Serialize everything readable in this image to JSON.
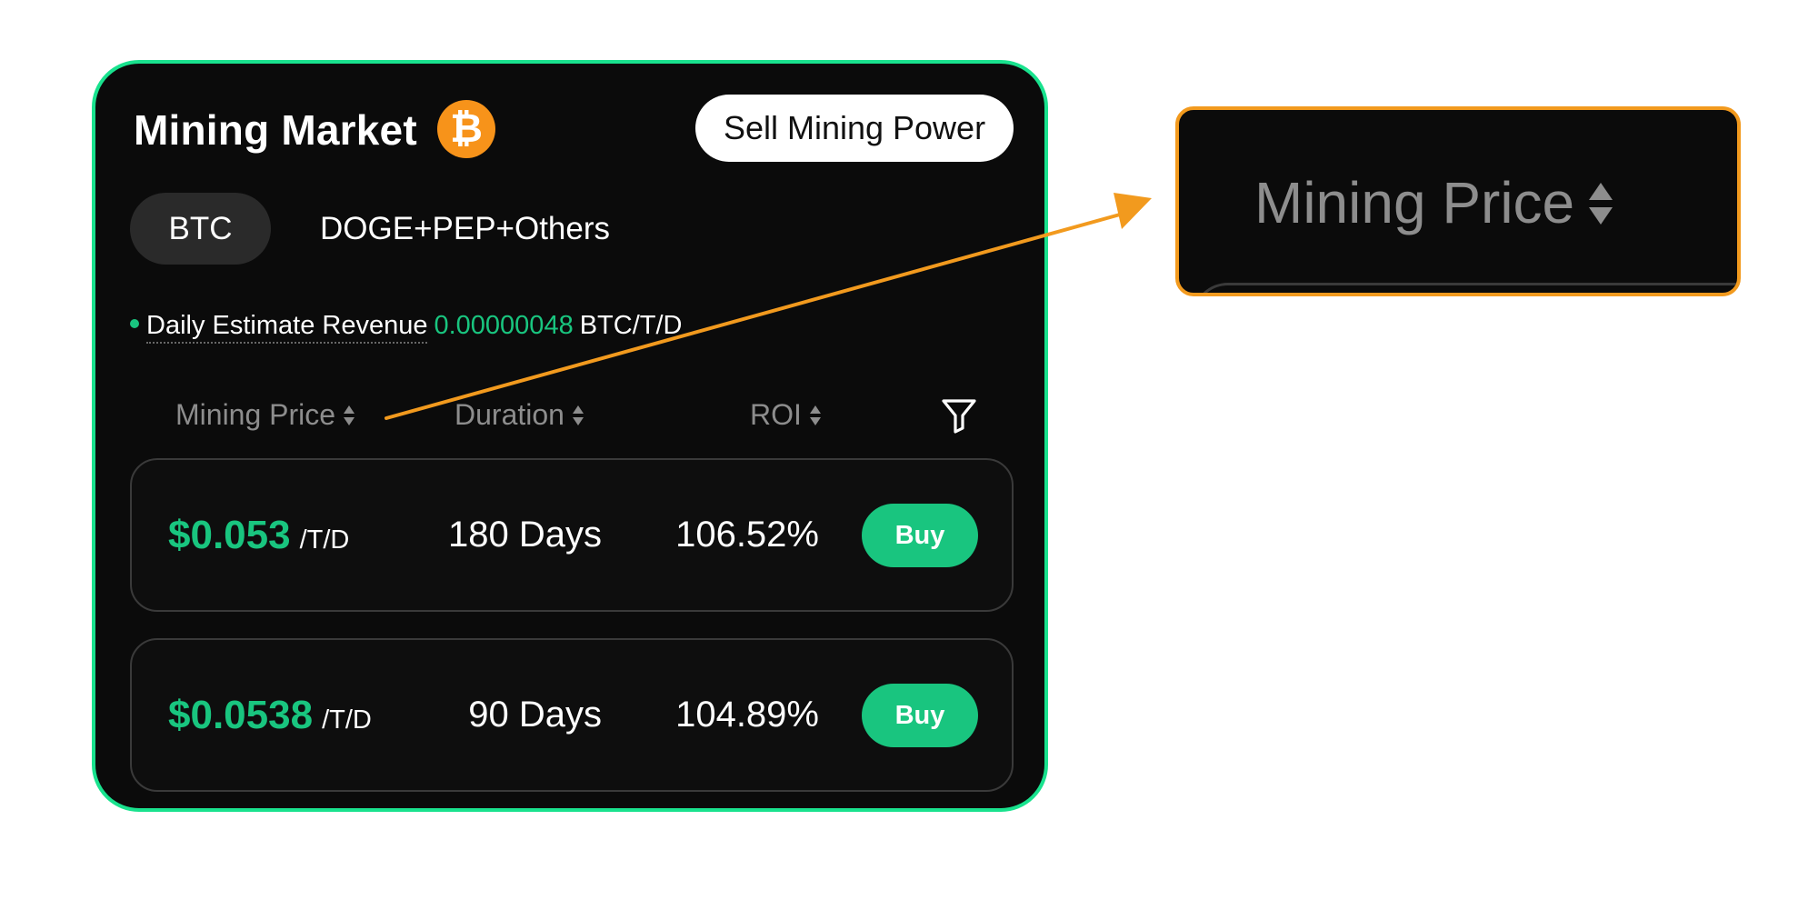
{
  "card": {
    "title": "Mining Market",
    "coin_symbol": "₿",
    "coin_icon": "bitcoin-icon",
    "sell_button": "Sell Mining Power",
    "tabs": [
      {
        "label": "BTC",
        "active": true
      },
      {
        "label": "DOGE+PEP+Others",
        "active": false
      }
    ],
    "revenue": {
      "label": "Daily Estimate Revenue",
      "value": "0.00000048",
      "unit": "BTC/T/D"
    },
    "columns": {
      "price": "Mining Price",
      "duration": "Duration",
      "roi": "ROI"
    },
    "rows": [
      {
        "price": "$0.053",
        "per": "/T/D",
        "duration": "180 Days",
        "roi": "106.52%",
        "button": "Buy"
      },
      {
        "price": "$0.0538",
        "per": "/T/D",
        "duration": "90 Days",
        "roi": "104.89%",
        "button": "Buy"
      }
    ]
  },
  "zoom": {
    "label": "Mining Price"
  },
  "colors": {
    "card_border": "#19e28e",
    "accent_green": "#19c57f",
    "callout_orange": "#f29a1e",
    "bitcoin_orange": "#f7931a",
    "background": "#0b0b0b"
  }
}
